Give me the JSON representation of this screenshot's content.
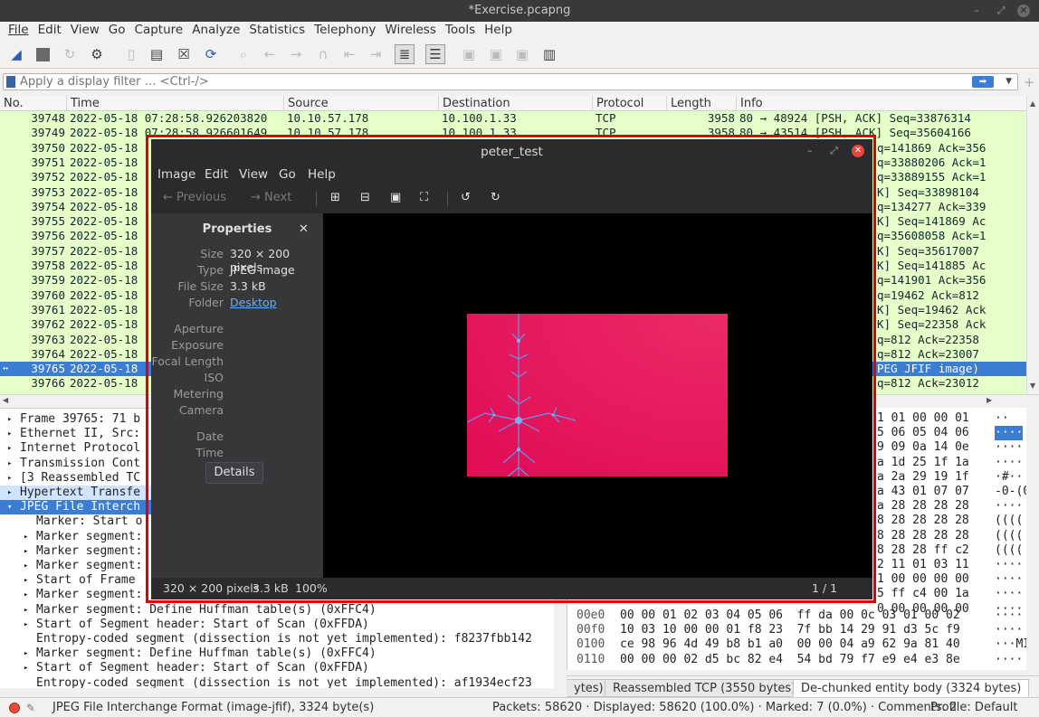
{
  "window": {
    "title": "*Exercise.pcapng"
  },
  "menu": [
    "File",
    "Edit",
    "View",
    "Go",
    "Capture",
    "Analyze",
    "Statistics",
    "Telephony",
    "Wireless",
    "Tools",
    "Help"
  ],
  "filter": {
    "placeholder": "Apply a display filter … <Ctrl-/>"
  },
  "columns": {
    "no": "No.",
    "time": "Time",
    "source": "Source",
    "destination": "Destination",
    "protocol": "Protocol",
    "length": "Length",
    "info": "Info"
  },
  "packets": [
    {
      "no": "39748",
      "time": "2022-05-18 07:28:58.926203820",
      "src": "10.10.57.178",
      "dst": "10.100.1.33",
      "proto": "TCP",
      "len": "3958",
      "info": "80 → 48924 [PSH, ACK] Seq=33876314"
    },
    {
      "no": "39749",
      "time": "2022-05-18 07:28:58.926601649",
      "src": "10.10.57.178",
      "dst": "10.100.1.33",
      "proto": "TCP",
      "len": "3958",
      "info": "80 → 43514 [PSH, ACK] Seq=35604166"
    },
    {
      "no": "39750",
      "time": "2022-05-18",
      "right": "q=141869 Ack=356"
    },
    {
      "no": "39751",
      "time": "2022-05-18",
      "right": "q=33880206 Ack=1"
    },
    {
      "no": "39752",
      "time": "2022-05-18",
      "right": "q=33889155 Ack=1"
    },
    {
      "no": "39753",
      "time": "2022-05-18",
      "right": "K] Seq=33898104"
    },
    {
      "no": "39754",
      "time": "2022-05-18",
      "right": "q=134277 Ack=339"
    },
    {
      "no": "39755",
      "time": "2022-05-18",
      "right": "K] Seq=141869 Ac"
    },
    {
      "no": "39756",
      "time": "2022-05-18",
      "right": "q=35608058 Ack=1"
    },
    {
      "no": "39757",
      "time": "2022-05-18",
      "right": "K] Seq=35617007"
    },
    {
      "no": "39758",
      "time": "2022-05-18",
      "right": "K] Seq=141885 Ac"
    },
    {
      "no": "39759",
      "time": "2022-05-18",
      "right": "q=141901 Ack=356"
    },
    {
      "no": "39760",
      "time": "2022-05-18",
      "right": "q=19462 Ack=812"
    },
    {
      "no": "39761",
      "time": "2022-05-18",
      "right": "K] Seq=19462 Ack"
    },
    {
      "no": "39762",
      "time": "2022-05-18",
      "right": "K] Seq=22358 Ack"
    },
    {
      "no": "39763",
      "time": "2022-05-18",
      "right": "q=812 Ack=22358"
    },
    {
      "no": "39764",
      "time": "2022-05-18",
      "right": "q=812 Ack=23007"
    },
    {
      "no": "39765",
      "time": "2022-05-18",
      "right": "PEG JFIF image)",
      "selected": true
    },
    {
      "no": "39766",
      "time": "2022-05-18",
      "right": "q=812 Ack=23012"
    }
  ],
  "details": [
    {
      "text": "Frame 39765: 71 b",
      "indent": 0
    },
    {
      "text": "Ethernet II, Src:",
      "indent": 0
    },
    {
      "text": "Internet Protocol",
      "indent": 0
    },
    {
      "text": "Transmission Cont",
      "indent": 0
    },
    {
      "text": "[3 Reassembled TC",
      "indent": 0
    },
    {
      "text": "Hypertext Transfe",
      "indent": 0,
      "highlight": true
    },
    {
      "text": "JPEG File Interch",
      "indent": 0,
      "selected": true,
      "open": true
    },
    {
      "text": "Marker: Start o",
      "indent": 1,
      "leaf": true
    },
    {
      "text": "Marker segment:",
      "indent": 1
    },
    {
      "text": "Marker segment:",
      "indent": 1
    },
    {
      "text": "Marker segment:",
      "indent": 1
    },
    {
      "text": "Start of Frame",
      "indent": 1
    },
    {
      "text": "Marker segment:",
      "indent": 1
    },
    {
      "text": "Marker segment: Define Huffman table(s) (0xFFC4)",
      "indent": 1
    },
    {
      "text": "Start of Segment header: Start of Scan (0xFFDA)",
      "indent": 1
    },
    {
      "text": "Entropy-coded segment (dissection is not yet implemented): f8237fbb142",
      "indent": 1,
      "leaf": true
    },
    {
      "text": "Marker segment: Define Huffman table(s) (0xFFC4)",
      "indent": 1
    },
    {
      "text": "Start of Segment header: Start of Scan (0xFFDA)",
      "indent": 1
    },
    {
      "text": "Entropy-coded segment (dissection is not yet implemented): af1934ecf23",
      "indent": 1,
      "leaf": true
    }
  ],
  "bytes_right": [
    {
      "hex": "1 01 00 00 01",
      "ascii": "··"
    },
    {
      "hex": "5 06 05 04 06",
      "ascii": "····"
    },
    {
      "hex": "9 09 0a 14 0e",
      "ascii": "····"
    },
    {
      "hex": "a 1d 25 1f 1a",
      "ascii": "····"
    },
    {
      "hex": "a 2a 29 19 1f",
      "ascii": "·#··"
    },
    {
      "hex": "a 43 01 07 07",
      "ascii": "-0-(0"
    },
    {
      "hex": "a 28 28 28 28",
      "ascii": "····"
    },
    {
      "hex": "8 28 28 28 28",
      "ascii": "(((("
    },
    {
      "hex": "8 28 28 28 28",
      "ascii": "(((("
    },
    {
      "hex": "8 28 28 ff c2",
      "ascii": "(((("
    },
    {
      "hex": "2 11 01 03 11",
      "ascii": "····"
    },
    {
      "hex": "1 00 00 00 00",
      "ascii": "····"
    },
    {
      "hex": "5 ff c4 00 1a",
      "ascii": "····"
    },
    {
      "hex": "0 00 00 00 00",
      "ascii": "····"
    }
  ],
  "bytes_full": [
    {
      "off": "00e0",
      "hex": "00 00 01 02 03 04 05 06  ff da 00 0c 03 01 00 02",
      "ascii": "····"
    },
    {
      "off": "00f0",
      "hex": "10 03 10 00 00 01 f8 23  7f bb 14 29 91 d3 5c f9",
      "ascii": "····"
    },
    {
      "off": "0100",
      "hex": "ce 98 96 4d 49 b8 b1 a0  00 00 04 a9 62 9a 81 40",
      "ascii": "···MI"
    },
    {
      "off": "0110",
      "hex": "00 00 00 02 d5 bc 82 e4  54 bd 79 f7 e9 e4 e3 8e",
      "ascii": "····"
    }
  ],
  "byte_tabs": [
    "ytes)",
    "Reassembled TCP (3550 bytes)",
    "De-chunked entity body (3324 bytes)"
  ],
  "status": {
    "left": "JPEG File Interchange Format (image-jfif), 3324 byte(s)",
    "packets": "Packets: 58620 · Displayed: 58620 (100.0%) · Marked: 7 (0.0%) · Comments: 2",
    "profile": "Profile: Default"
  },
  "viewer": {
    "title": "peter_test",
    "menu": [
      "Image",
      "Edit",
      "View",
      "Go",
      "Help"
    ],
    "toolbar": {
      "previous": "Previous",
      "next": "Next"
    },
    "properties": {
      "heading": "Properties",
      "size_label": "Size",
      "size": "320 × 200 pixels",
      "type_label": "Type",
      "type": "JPEG image",
      "filesize_label": "File Size",
      "filesize": "3.3 kB",
      "folder_label": "Folder",
      "folder": "Desktop",
      "aperture_label": "Aperture",
      "exposure_label": "Exposure",
      "focal_label": "Focal Length",
      "iso_label": "ISO",
      "metering_label": "Metering",
      "camera_label": "Camera",
      "date_label": "Date",
      "time_label": "Time",
      "details_button": "Details"
    },
    "status": {
      "dims": "320 × 200 pixels",
      "size": "3.3 kB",
      "zoom": "100%",
      "page": "1 / 1"
    }
  },
  "colors": {
    "packet_bg": "#e4ffc7",
    "selection": "#3a7dd3",
    "viewer_bg": "#2b2b2d",
    "highlight_frame": "#e00000",
    "image_pink": "#e8125e"
  }
}
